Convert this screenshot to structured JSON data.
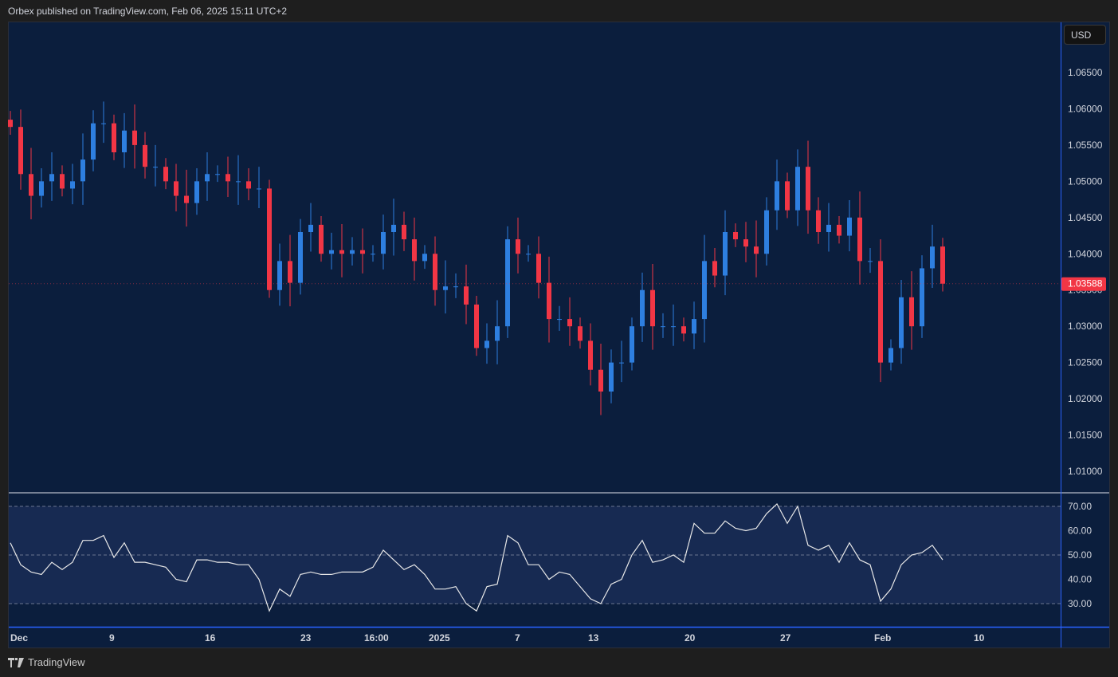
{
  "header": {
    "published": "Orbex published on TradingView.com, Feb 06, 2025 15:11 UTC+2"
  },
  "currency_button": "USD",
  "brand": "TradingView",
  "colors": {
    "up": "#2e7fe0",
    "down": "#f23645",
    "bg": "#0b1e3d",
    "rsi_band": "#172a52"
  },
  "chart_data": [
    {
      "type": "candlestick",
      "title": "EURUSD",
      "ylim": [
        1.0055,
        1.0695
      ],
      "yticks": [
        "1.06500",
        "1.06000",
        "1.05500",
        "1.05000",
        "1.04500",
        "1.04000",
        "1.03500",
        "1.03000",
        "1.02500",
        "1.02000",
        "1.01500",
        "1.01000"
      ],
      "last_price": "1.03588",
      "xticks": [
        "Dec",
        "9",
        "16",
        "23",
        "16:00",
        "2025",
        "7",
        "13",
        "20",
        "27",
        "Feb",
        "10"
      ],
      "first_open": 1.0585,
      "closes": [
        1.0575,
        1.051,
        1.048,
        1.05,
        1.051,
        1.049,
        1.05,
        1.053,
        1.058,
        1.058,
        1.054,
        1.057,
        1.055,
        1.052,
        1.052,
        1.05,
        1.048,
        1.047,
        1.05,
        1.051,
        1.051,
        1.05,
        1.05,
        1.049,
        1.049,
        1.035,
        1.039,
        1.036,
        1.043,
        1.044,
        1.04,
        1.0405,
        1.04,
        1.0405,
        1.04,
        1.04,
        1.043,
        1.044,
        1.042,
        1.039,
        1.04,
        1.035,
        1.0355,
        1.0355,
        1.033,
        1.027,
        1.028,
        1.03,
        1.042,
        1.04,
        1.04,
        1.036,
        1.031,
        1.031,
        1.03,
        1.028,
        1.024,
        1.021,
        1.025,
        1.025,
        1.03,
        1.035,
        1.03,
        1.03,
        1.03,
        1.029,
        1.031,
        1.039,
        1.037,
        1.043,
        1.042,
        1.041,
        1.04,
        1.046,
        1.05,
        1.046,
        1.052,
        1.046,
        1.043,
        1.044,
        1.0425,
        1.045,
        1.039,
        1.039,
        1.025,
        1.027,
        1.034,
        1.03,
        1.038,
        1.041,
        1.03588
      ]
    },
    {
      "type": "line",
      "title": "RSI",
      "ylim": [
        22,
        80
      ],
      "yticks": [
        "70.00",
        "60.00",
        "50.00",
        "40.00",
        "30.00"
      ],
      "bands": [
        70,
        50,
        30
      ],
      "values": [
        55,
        46,
        43,
        42,
        47,
        44,
        47,
        56,
        56,
        58,
        49,
        55,
        47,
        47,
        46,
        45,
        40,
        39,
        48,
        48,
        47,
        47,
        46,
        46,
        40,
        27,
        36,
        33,
        42,
        43,
        42,
        42,
        43,
        43,
        43,
        45,
        52,
        48,
        44,
        46,
        42,
        36,
        36,
        37,
        30,
        27,
        37,
        38,
        58,
        55,
        46,
        46,
        40,
        43,
        42,
        37,
        32,
        30,
        38,
        40,
        50,
        56,
        47,
        48,
        50,
        47,
        63,
        59,
        59,
        64,
        61,
        60,
        61,
        67,
        71,
        63,
        70,
        54,
        52,
        54,
        47,
        55,
        48,
        46,
        31,
        36,
        46,
        50,
        51,
        54,
        48
      ]
    }
  ]
}
